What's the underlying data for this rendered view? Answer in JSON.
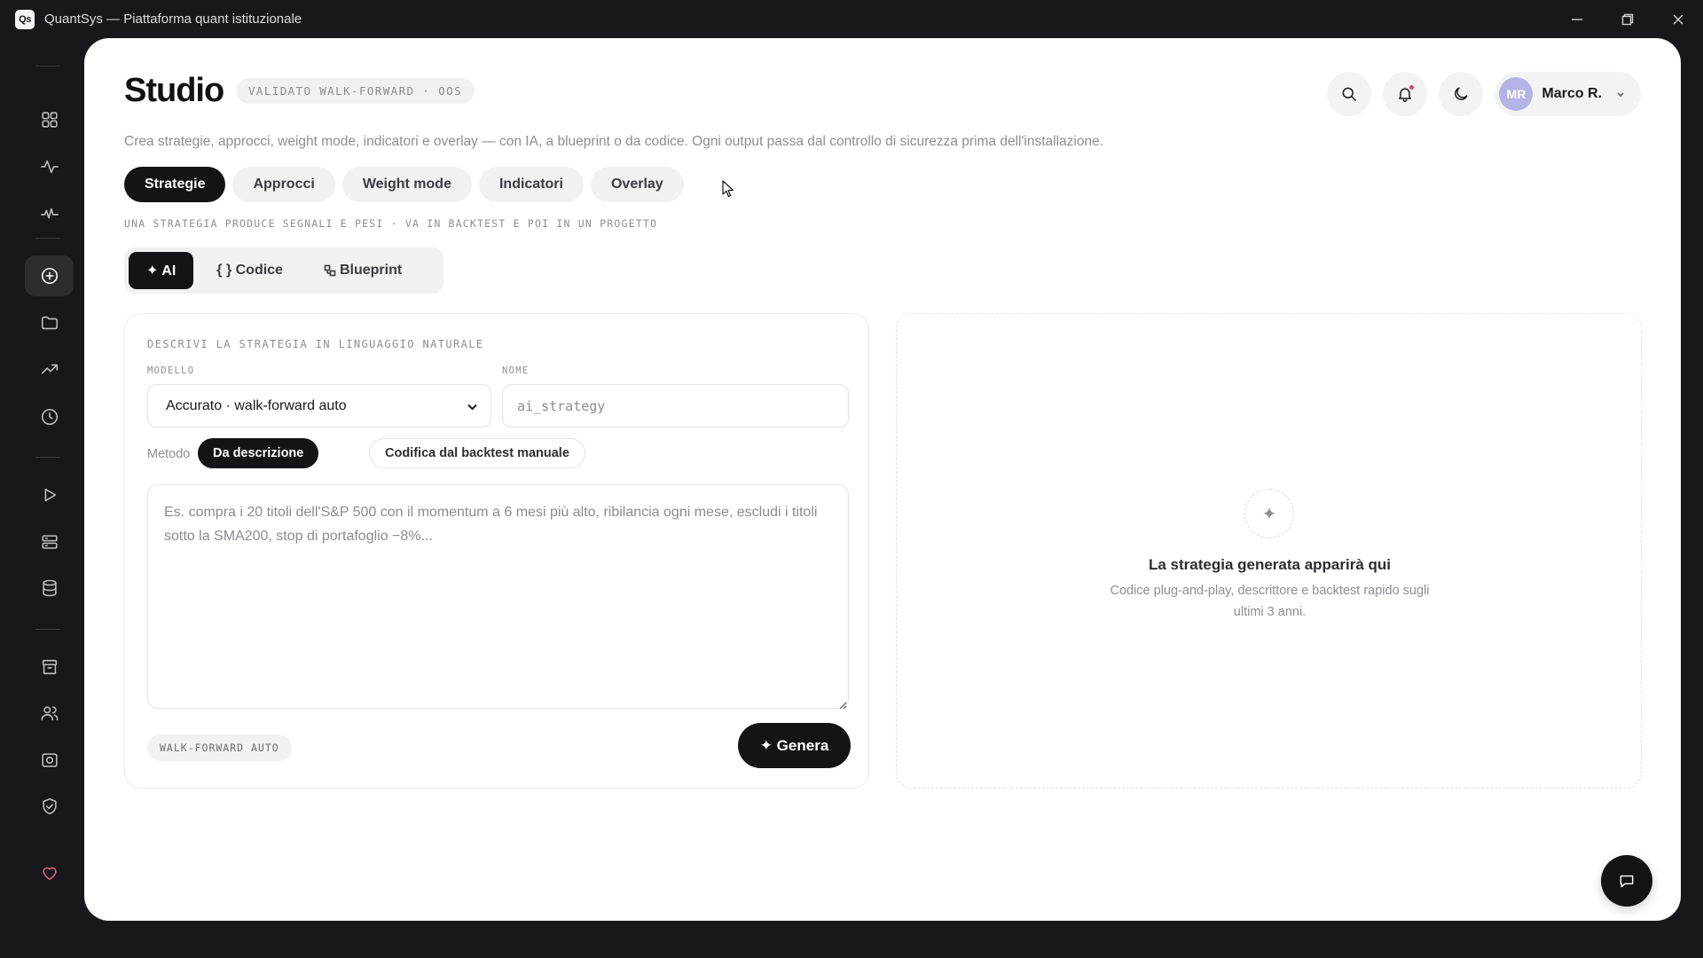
{
  "window": {
    "app_logo": "Qs",
    "title": "QuantSys — Piattaforma quant istituzionale"
  },
  "sidebar": {
    "items": [
      {
        "icon": "grid-icon"
      },
      {
        "icon": "activity-icon"
      },
      {
        "icon": "pulse-icon"
      },
      {
        "icon": "plus-circle-icon",
        "active": true
      },
      {
        "icon": "folder-icon"
      },
      {
        "icon": "trending-up-icon"
      },
      {
        "icon": "history-icon"
      },
      {
        "icon": "play-icon"
      },
      {
        "icon": "server-icon"
      },
      {
        "icon": "database-icon"
      },
      {
        "icon": "archive-icon"
      },
      {
        "icon": "users-icon"
      },
      {
        "icon": "camera-icon"
      },
      {
        "icon": "shield-check-icon"
      },
      {
        "icon": "heart-icon"
      }
    ]
  },
  "header": {
    "title": "Studio",
    "badge": "VALIDATO WALK-FORWARD · OOS",
    "subtitle": "Crea strategie, approcci, weight mode, indicatori e overlay — con IA, a blueprint o da codice. Ogni output passa dal controllo di sicurezza prima dell'installazione.",
    "user": {
      "initials": "MR",
      "name": "Marco R."
    }
  },
  "tabs": [
    {
      "label": "Strategie",
      "active": true
    },
    {
      "label": "Approcci"
    },
    {
      "label": "Weight mode"
    },
    {
      "label": "Indicatori"
    },
    {
      "label": "Overlay"
    }
  ],
  "caption": "UNA STRATEGIA PRODUCE SEGNALI E PESI · VA IN BACKTEST E POI IN UN PROGETTO",
  "modes": [
    {
      "label": "✦ AI",
      "active": true
    },
    {
      "label": "{ } Codice"
    },
    {
      "label": "Blueprint"
    }
  ],
  "form": {
    "section_label": "DESCRIVI LA STRATEGIA IN LINGUAGGIO NATURALE",
    "model_label": "MODELLO",
    "model_value": "Accurato · walk-forward auto",
    "name_label": "NOME",
    "name_placeholder": "ai_strategy",
    "method_label": "Metodo",
    "method_active": "Da descrizione",
    "method_other": "Codifica dal backtest manuale",
    "description_placeholder": "Es. compra i 20 titoli dell'S&P 500 con il momentum a 6 mesi più alto, ribilancia ogni mese, escludi i titoli sotto la SMA200, stop di portafoglio −8%...",
    "badge": "WALK-FORWARD AUTO",
    "generate_label": "✦ Genera"
  },
  "preview": {
    "icon": "✦",
    "title": "La strategia generata apparirà qui",
    "description": "Codice plug-and-play, descrittore e backtest rapido sugli ultimi 3 anni."
  },
  "colors": {
    "accent": "#141416",
    "sidebar_bg": "#17181b",
    "notification": "#e0465b",
    "avatar": "#b5b2e6"
  }
}
